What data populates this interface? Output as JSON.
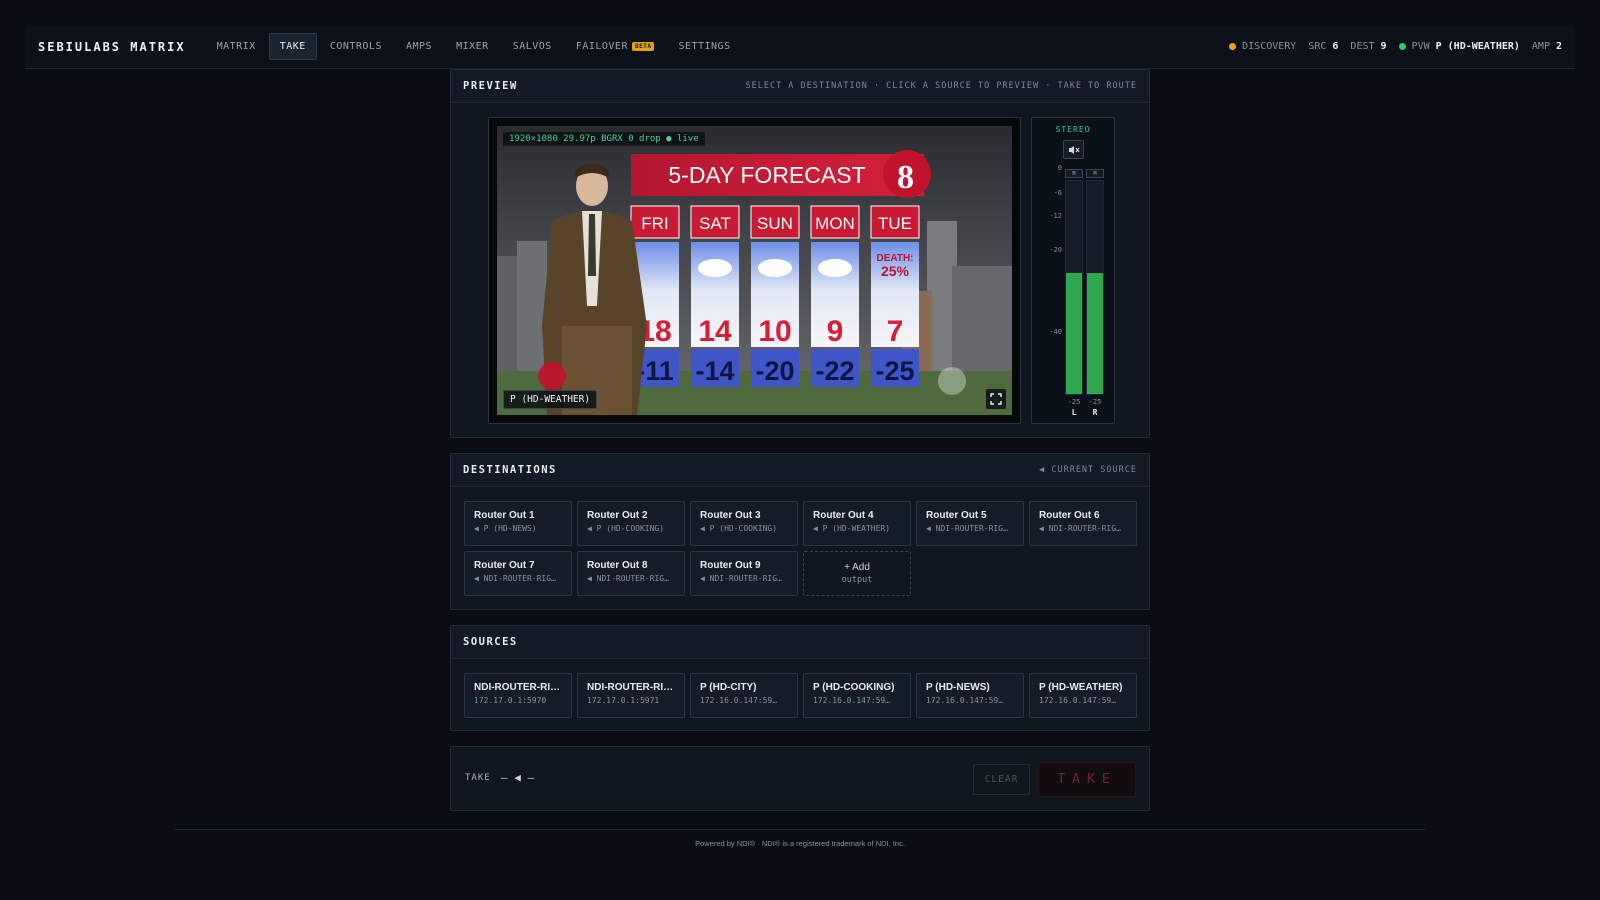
{
  "app": {
    "brand": "SEBIULABS MATRIX"
  },
  "nav": [
    {
      "label": "MATRIX",
      "active": false
    },
    {
      "label": "TAKE",
      "active": true
    },
    {
      "label": "CONTROLS",
      "active": false
    },
    {
      "label": "AMPS",
      "active": false
    },
    {
      "label": "MIXER",
      "active": false
    },
    {
      "label": "SALVOS",
      "active": false
    },
    {
      "label": "FAILOVER",
      "badge": "BETA",
      "active": false
    },
    {
      "label": "SETTINGS",
      "active": false
    }
  ],
  "status": {
    "discovery": "DISCOVERY",
    "src_label": "SRC",
    "src_value": "6",
    "dest_label": "DEST",
    "dest_value": "9",
    "pvw_label": "PVW",
    "pvw_value": "P (HD-WEATHER)",
    "amp_label": "AMP",
    "amp_value": "2",
    "discovery_color": "#f0a020",
    "pvw_color": "#2ecc71"
  },
  "preview": {
    "title": "PREVIEW",
    "hint": "SELECT A DESTINATION · CLICK A SOURCE TO PREVIEW · TAKE TO ROUTE",
    "video_info": "1920×1080 29.97p BGRX 0 drop ● live",
    "video_source": "P (HD-WEATHER)",
    "forecast": {
      "title": "5-DAY FORECAST",
      "days": [
        "FRI",
        "SAT",
        "SUN",
        "MON",
        "TUE"
      ],
      "highs": [
        "18",
        "14",
        "10",
        "9",
        "7"
      ],
      "lows": [
        "-11",
        "-14",
        "-20",
        "-22",
        "-25"
      ],
      "note_line1": "DEATH:",
      "note_line2": "25%"
    },
    "meter": {
      "title": "STEREO",
      "scale": [
        "0",
        "-6",
        "-12",
        "-20",
        "-40"
      ],
      "m_label": "M",
      "channels": [
        {
          "name": "L",
          "value": "-25",
          "level": 0.57
        },
        {
          "name": "R",
          "value": "-25",
          "level": 0.57
        }
      ]
    }
  },
  "destinations": {
    "title": "DESTINATIONS",
    "hint": "◀ CURRENT SOURCE",
    "items": [
      {
        "name": "Router Out 1",
        "source": "◀ P (HD-NEWS)"
      },
      {
        "name": "Router Out 2",
        "source": "◀ P (HD-COOKING)"
      },
      {
        "name": "Router Out 3",
        "source": "◀ P (HD-COOKING)"
      },
      {
        "name": "Router Out 4",
        "source": "◀ P (HD-WEATHER)"
      },
      {
        "name": "Router Out 5",
        "source": "◀ NDI-ROUTER-RIG…"
      },
      {
        "name": "Router Out 6",
        "source": "◀ NDI-ROUTER-RIG…"
      },
      {
        "name": "Router Out 7",
        "source": "◀ NDI-ROUTER-RIG…"
      },
      {
        "name": "Router Out 8",
        "source": "◀ NDI-ROUTER-RIG…"
      },
      {
        "name": "Router Out 9",
        "source": "◀ NDI-ROUTER-RIG…"
      }
    ],
    "add_line1": "+ Add",
    "add_line2": "output"
  },
  "sources": {
    "title": "SOURCES",
    "items": [
      {
        "name": "NDI-ROUTER-RIG ...",
        "address": "172.17.0.1:5970"
      },
      {
        "name": "NDI-ROUTER-RIG ...",
        "address": "172.17.0.1:5971"
      },
      {
        "name": "P (HD-CITY)",
        "address": "172.16.0.147:59…"
      },
      {
        "name": "P (HD-COOKING)",
        "address": "172.16.0.147:59…"
      },
      {
        "name": "P (HD-NEWS)",
        "address": "172.16.0.147:59…"
      },
      {
        "name": "P (HD-WEATHER)",
        "address": "172.16.0.147:59…"
      }
    ]
  },
  "take": {
    "label": "TAKE",
    "route": "— ◀ —",
    "clear": "CLEAR",
    "take_button": "TAKE"
  },
  "footer": "Powered by NDI® · NDI® is a registered trademark of NDI, Inc."
}
